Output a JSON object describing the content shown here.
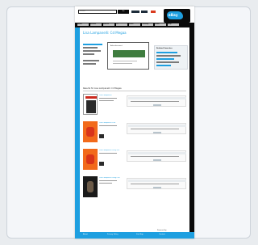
{
  "page": {
    "title": "Lisa Lampanelli: Cd Megaa"
  },
  "search": {
    "placeholder": "Search",
    "button_label": "Go"
  },
  "brand": {
    "logo_text": "eBay"
  },
  "nav": {
    "items": [
      "Home",
      "Browse",
      "Movies",
      "TV",
      "Music",
      "Comedy",
      "Deals",
      "Help"
    ]
  },
  "sidebar_box": {
    "title": "Related Searches"
  },
  "ad": {
    "label": "Advertisement"
  },
  "results": {
    "heading": "Results for Lisa Lampanelli: Cd Megaa",
    "items": [
      {
        "title": "Lisa Lampanelli",
        "cover": "white"
      },
      {
        "title": "Lisa Lampanelli Live",
        "cover": "orange"
      },
      {
        "title": "Lisa Lampanelli Dirty Girl",
        "cover": "orange"
      },
      {
        "title": "Lisa Lampanelli Long Live",
        "cover": "dark"
      }
    ]
  },
  "footer_note": {
    "label": "Powered by"
  },
  "footer": {
    "links": [
      "About",
      "Privacy Policy",
      "Site Map",
      "Contact"
    ]
  },
  "colors": {
    "accent": "#1e9fe0",
    "dark": "#0a0a0a",
    "orange_cover": "#f26a1b"
  }
}
